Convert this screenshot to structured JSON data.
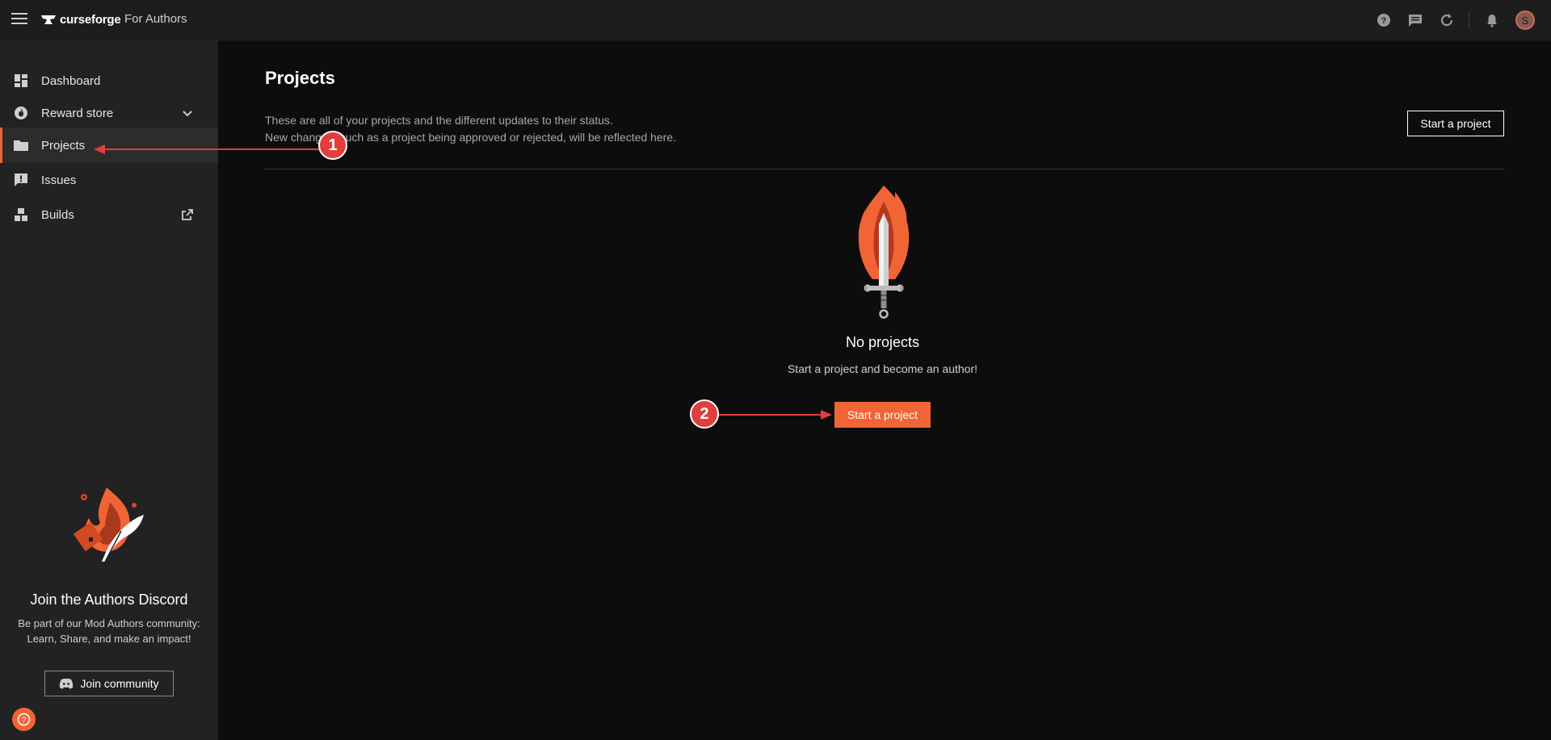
{
  "topbar": {
    "logo_text": "curseforge",
    "subtitle": "For Authors",
    "avatar_letter": "S",
    "icons": [
      "help-icon",
      "chat-icon",
      "refresh-icon",
      "bell-icon"
    ]
  },
  "sidebar": {
    "items": [
      {
        "label": "Dashboard",
        "icon": "dashboard-icon"
      },
      {
        "label": "Reward store",
        "icon": "flame-icon"
      },
      {
        "label": "Projects",
        "icon": "folder-icon"
      },
      {
        "label": "Issues",
        "icon": "issue-icon"
      },
      {
        "label": "Builds",
        "icon": "builds-icon"
      }
    ],
    "discord": {
      "title": "Join the Authors Discord",
      "desc_line1": "Be part of our Mod Authors community:",
      "desc_line2": "Learn, Share, and make an impact!",
      "button": "Join community"
    }
  },
  "main": {
    "title": "Projects",
    "desc_line1": "These are all of your projects and the different updates to their status.",
    "desc_line2": "New changes, such as a project being approved or rejected, will be reflected here.",
    "start_button": "Start a project",
    "empty": {
      "title": "No projects",
      "desc": "Start a project and become an author!",
      "button": "Start a project"
    }
  },
  "annotations": {
    "step1": "1",
    "step2": "2"
  },
  "colors": {
    "accent": "#f16436",
    "annotation": "#e23e3e",
    "background": "#0d0d0d",
    "sidebar": "#222222"
  }
}
